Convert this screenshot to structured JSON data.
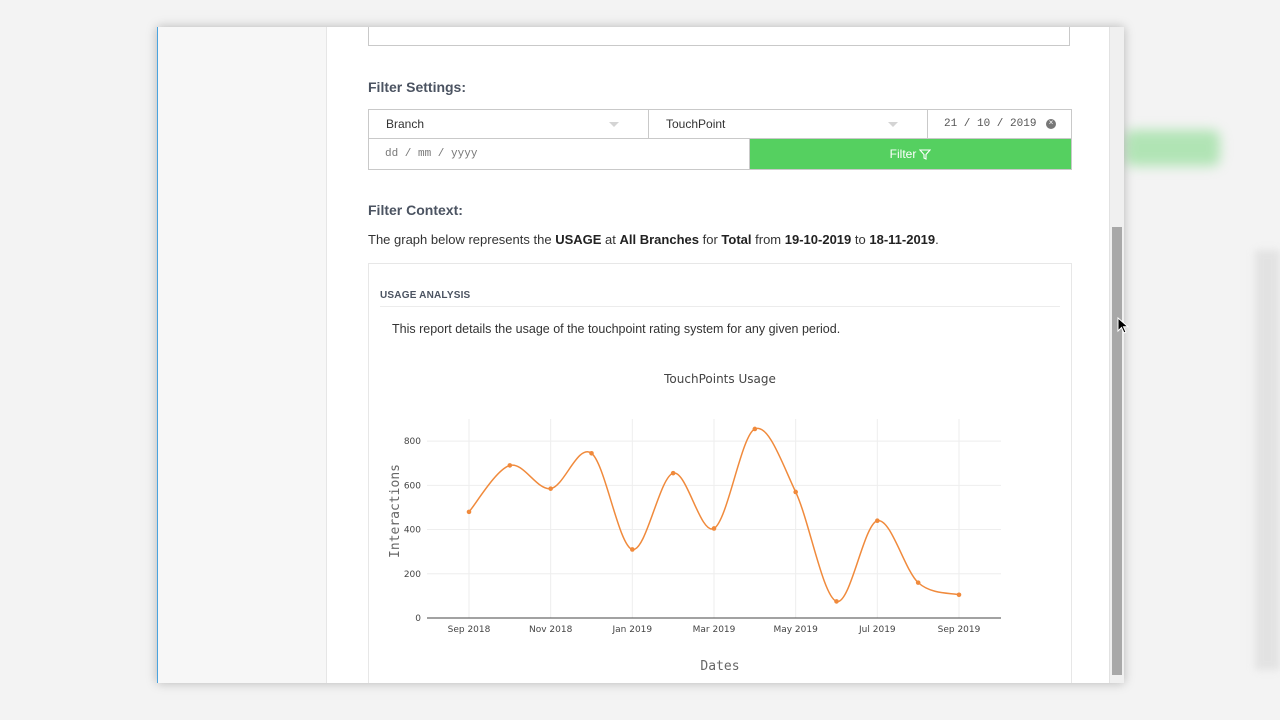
{
  "filter_settings": {
    "heading": "Filter Settings:",
    "branch_select": "Branch",
    "touchpoint_select": "TouchPoint",
    "end_date": "21 / 10 / 2019",
    "start_date_placeholder": "dd / mm / yyyy",
    "filter_button": "Filter"
  },
  "filter_context": {
    "heading": "Filter Context:",
    "sentence": {
      "prefix": "The graph below represents the",
      "metric": "USAGE",
      "at_word": "at",
      "branch": "All Branches",
      "for_word": "for",
      "touchpoint": "Total",
      "from_word": "from",
      "from_date": "19-10-2019",
      "to_word": "to",
      "to_date": "18-11-2019",
      "suffix": "."
    }
  },
  "panel": {
    "title": "USAGE ANALYSIS",
    "description": "This report details the usage of the touchpoint rating system for any given period."
  },
  "chart_data": {
    "type": "line",
    "title": "TouchPoints Usage",
    "xlabel": "Dates",
    "ylabel": "Interactions",
    "x": [
      "Sep 2018",
      "Oct 2018",
      "Nov 2018",
      "Dec 2018",
      "Jan 2019",
      "Feb 2019",
      "Mar 2019",
      "Apr 2019",
      "May 2019",
      "Jun 2019",
      "Jul 2019",
      "Aug 2019",
      "Sep 2019"
    ],
    "x_tick_labels": [
      "Sep 2018",
      "Nov 2018",
      "Jan 2019",
      "Mar 2019",
      "May 2019",
      "Jul 2019",
      "Sep 2019"
    ],
    "series": [
      {
        "values": [
          480,
          690,
          585,
          745,
          310,
          655,
          405,
          855,
          570,
          75,
          440,
          160,
          105
        ],
        "color": "#f08a3c"
      }
    ],
    "ylim": [
      0,
      900
    ],
    "yticks": [
      0,
      200,
      400,
      600,
      800
    ],
    "grid": true
  }
}
